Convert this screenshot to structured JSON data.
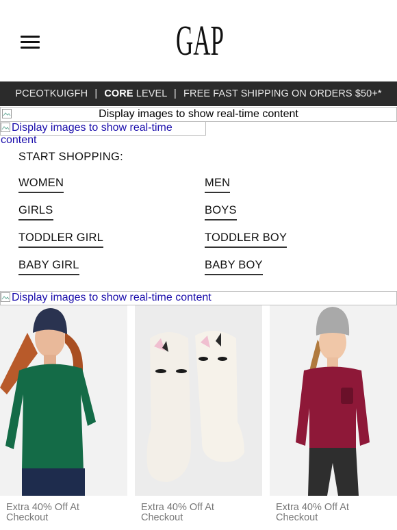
{
  "header": {
    "menu_icon": "hamburger-menu-icon",
    "logo_text": "GAP"
  },
  "banner": {
    "member_code": "PCEOTKUIGFH",
    "separator": "|",
    "level_bold": "CORE",
    "level_rest": " LEVEL",
    "shipping": "FREE FAST SHIPPING ON ORDERS $50+*"
  },
  "image_placeholders": [
    "Display images to show real-time content",
    "Display images to show real-time content",
    "Display images to show real-time content"
  ],
  "shopping": {
    "title": "START SHOPPING:",
    "links": [
      "WOMEN",
      "MEN",
      "GIRLS",
      "BOYS",
      "TODDLER GIRL",
      "TODDLER BOY",
      "BABY GIRL",
      "BABY BOY"
    ]
  },
  "products": [
    {
      "caption": "Extra 40% Off At\nCheckout",
      "line1": "Extra 40% Off At",
      "line2": "Checkout",
      "image": "woman-green-sweater-beanie"
    },
    {
      "caption": "Extra 40% Off At\nCheckout",
      "line1": "Extra 40% Off At",
      "line2": "Checkout",
      "image": "fuzzy-unicorn-socks"
    },
    {
      "caption": "Extra 40% Off At\nCheckout",
      "line1": "Extra 40% Off At",
      "line2": "Checkout",
      "image": "girl-red-top-grey-beanie"
    }
  ],
  "colors": {
    "banner_bg": "#2b2b2b",
    "link_blue": "#1a0dab",
    "caption_grey": "#777777"
  }
}
